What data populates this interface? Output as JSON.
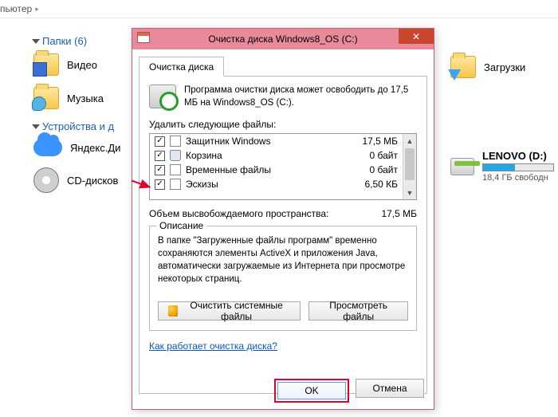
{
  "crumb": {
    "label": "пьютер",
    "sep": "▸"
  },
  "sections": {
    "folders": "Папки (6)",
    "devices": "Устройства и д"
  },
  "items": {
    "video": "Видео",
    "music": "Музыка",
    "downloads": "Загрузки",
    "yadisk": "Яндекс.Ди",
    "cd": "CD-дисков"
  },
  "drive": {
    "name": "LENOVO (D:)",
    "free": "18,4 ГБ свободн"
  },
  "dialog": {
    "title": "Очистка диска Windows8_OS (C:)",
    "close": "✕",
    "tab": "Очистка диска",
    "intro": "Программа очистки диска может освободить до 17,5 МБ на Windows8_OS (C:).",
    "listLabel": "Удалить следующие файлы:",
    "rows": [
      {
        "name": "Защитник Windows",
        "size": "17,5 МБ",
        "checked": true,
        "icon": "page"
      },
      {
        "name": "Корзина",
        "size": "0 байт",
        "checked": true,
        "icon": "bin"
      },
      {
        "name": "Временные файлы",
        "size": "0 байт",
        "checked": true,
        "icon": "page"
      },
      {
        "name": "Эскизы",
        "size": "6,50 КБ",
        "checked": true,
        "icon": "page"
      }
    ],
    "totalLabel": "Объем высвобождаемого пространства:",
    "totalValue": "17,5 МБ",
    "group": {
      "legend": "Описание",
      "desc": "В папке \"Загруженные файлы программ\" временно сохраняются элементы ActiveX и приложения Java, автоматически загружаемые из Интернета при просмотре некоторых страниц."
    },
    "btnSys": "Очистить системные файлы",
    "btnView": "Просмотреть файлы",
    "link": "Как работает очистка диска?",
    "ok": "OK",
    "cancel": "Отмена"
  }
}
